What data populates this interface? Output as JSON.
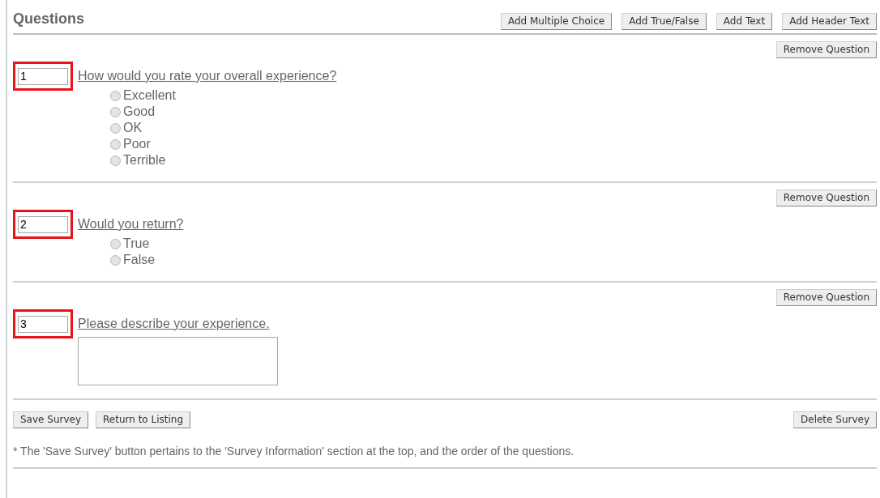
{
  "section_title": "Questions",
  "add_buttons": [
    "Add Multiple Choice",
    "Add True/False",
    "Add Text",
    "Add Header Text"
  ],
  "questions": [
    {
      "kind": "choice",
      "remove_button": "Remove Question",
      "order": "1",
      "text": "How would you rate your overall experience?",
      "highlighted": true,
      "options": [
        {
          "label": "Excellent",
          "selected": false
        },
        {
          "label": "Good",
          "selected": false
        },
        {
          "label": "OK",
          "selected": false
        },
        {
          "label": "Poor",
          "selected": false
        },
        {
          "label": "Terrible",
          "selected": false
        }
      ]
    },
    {
      "kind": "choice",
      "remove_button": "Remove Question",
      "order": "2",
      "text": "Would you return?",
      "highlighted": true,
      "options": [
        {
          "label": "True",
          "selected": false
        },
        {
          "label": "False",
          "selected": false
        }
      ]
    },
    {
      "kind": "text",
      "remove_button": "Remove Question",
      "order": "3",
      "text": "Please describe your experience.",
      "highlighted": true
    }
  ],
  "footer_buttons": [
    "Save Survey",
    "Return to Listing"
  ],
  "delete_button": "Delete Survey",
  "footnote": "* The 'Save Survey' button pertains to the 'Survey Information' section at the top, and the order of the questions."
}
